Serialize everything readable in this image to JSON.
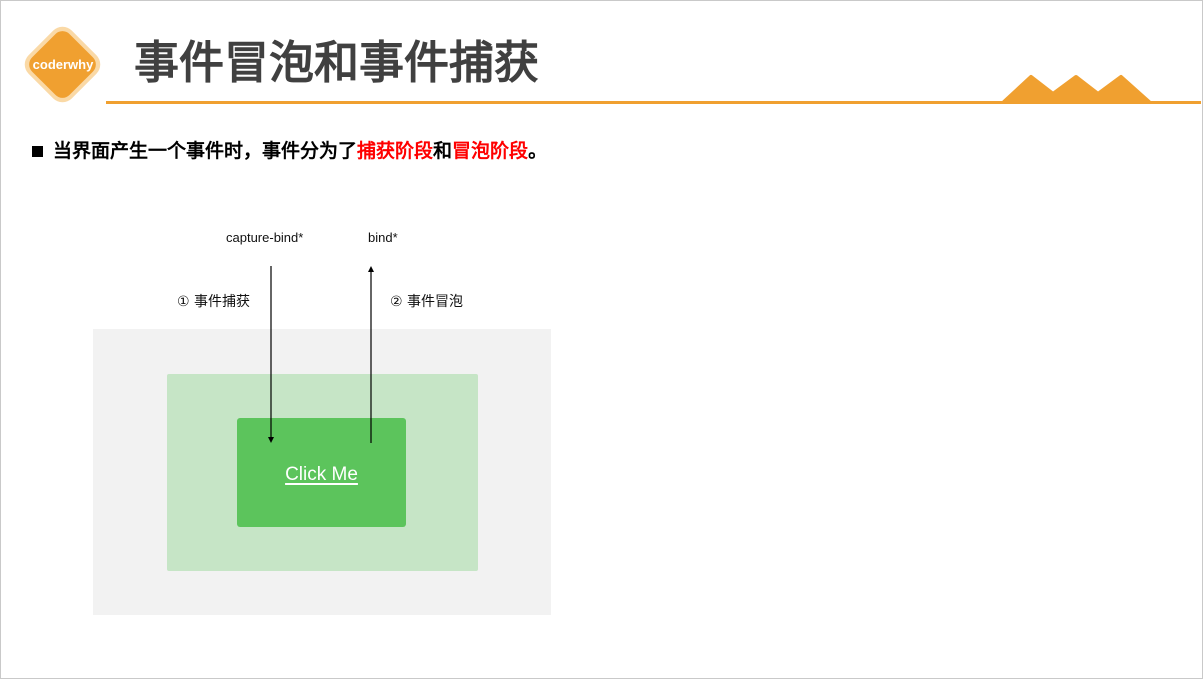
{
  "logo": {
    "text": "coderwhy"
  },
  "title": "事件冒泡和事件捕获",
  "bullet": {
    "parts": [
      {
        "text": "当界面产生一个事件时，事件分为了",
        "emphasis": false
      },
      {
        "text": "捕获阶段",
        "emphasis": true
      },
      {
        "text": "和",
        "emphasis": false
      },
      {
        "text": "冒泡阶段",
        "emphasis": true
      },
      {
        "text": "。",
        "emphasis": false
      }
    ]
  },
  "diagram": {
    "capture_label": "capture-bind*",
    "bubble_label": "bind*",
    "capture_step": "① 事件捕获",
    "bubble_step": "② 事件冒泡",
    "button_label": "Click Me"
  },
  "colors": {
    "accent": "#F0A030",
    "emphasis": "#FF0000",
    "title": "#404040",
    "outer_box": "#F2F2F2",
    "middle_box": "#C6E5C6",
    "inner_box": "#5CC45C"
  }
}
